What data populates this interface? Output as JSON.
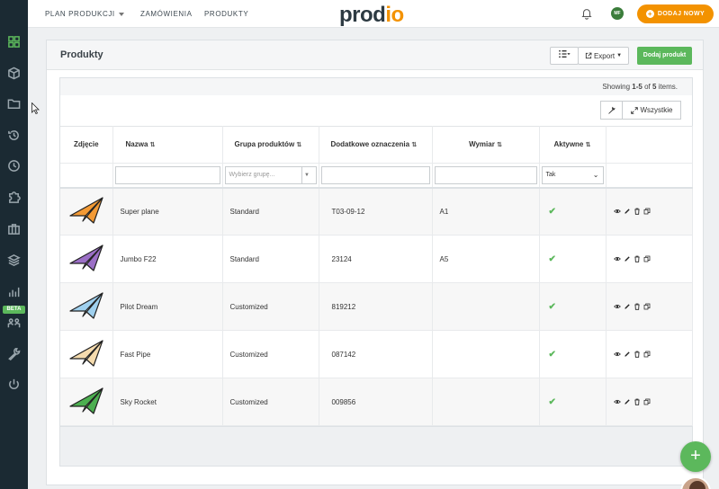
{
  "nav": {
    "plan": "PLAN PRODUKCJI",
    "orders": "ZAMÓWIENIA",
    "products": "PRODUKTY",
    "avatar_initials": "MF",
    "add_new": "DODAJ NOWY"
  },
  "logo": {
    "text": "prod",
    "accent": "io"
  },
  "sidebar": {
    "items": [
      "grid-icon",
      "cube-icon",
      "folder-icon",
      "history-icon",
      "clock-icon",
      "puzzle-icon",
      "briefcase-icon",
      "layers-icon",
      "bar-chart-icon",
      "team-icon",
      "wrench-icon",
      "power-icon"
    ],
    "beta_label": "BETA"
  },
  "panel": {
    "title": "Produkty",
    "export_label": "Export",
    "add_product_label": "Dodaj produkt"
  },
  "grid": {
    "summary_prefix": "Showing ",
    "summary_range": "1-5",
    "summary_of": " of ",
    "summary_total": "5",
    "summary_suffix": " items.",
    "all_label": "Wszystkie",
    "columns": {
      "photo": "Zdjęcie",
      "name": "Nazwa",
      "group": "Grupa produktów",
      "extra": "Dodatkowe oznaczenia",
      "dimension": "Wymiar",
      "active": "Aktywne"
    },
    "filters": {
      "group_placeholder": "Wybierz grupę...",
      "active_value": "Tak"
    },
    "rows": [
      {
        "name": "Super plane",
        "group": "Standard",
        "code": "T03-09-12",
        "dimension": "A1",
        "active": true,
        "color": "#f39a35"
      },
      {
        "name": "Jumbo F22",
        "group": "Standard",
        "code": "23124",
        "dimension": "A5",
        "active": true,
        "color": "#9b6fc6"
      },
      {
        "name": "Pilot Dream",
        "group": "Customized",
        "code": "819212",
        "dimension": "",
        "active": true,
        "color": "#9fd0ee"
      },
      {
        "name": "Fast Pipe",
        "group": "Customized",
        "code": "087142",
        "dimension": "",
        "active": true,
        "color": "#f6dcae"
      },
      {
        "name": "Sky Rocket",
        "group": "Customized",
        "code": "009856",
        "dimension": "",
        "active": true,
        "color": "#4caf50"
      }
    ]
  },
  "colors": {
    "accent": "#5cb85c",
    "brand": "#f39200",
    "sidebar": "#1b2a33"
  }
}
